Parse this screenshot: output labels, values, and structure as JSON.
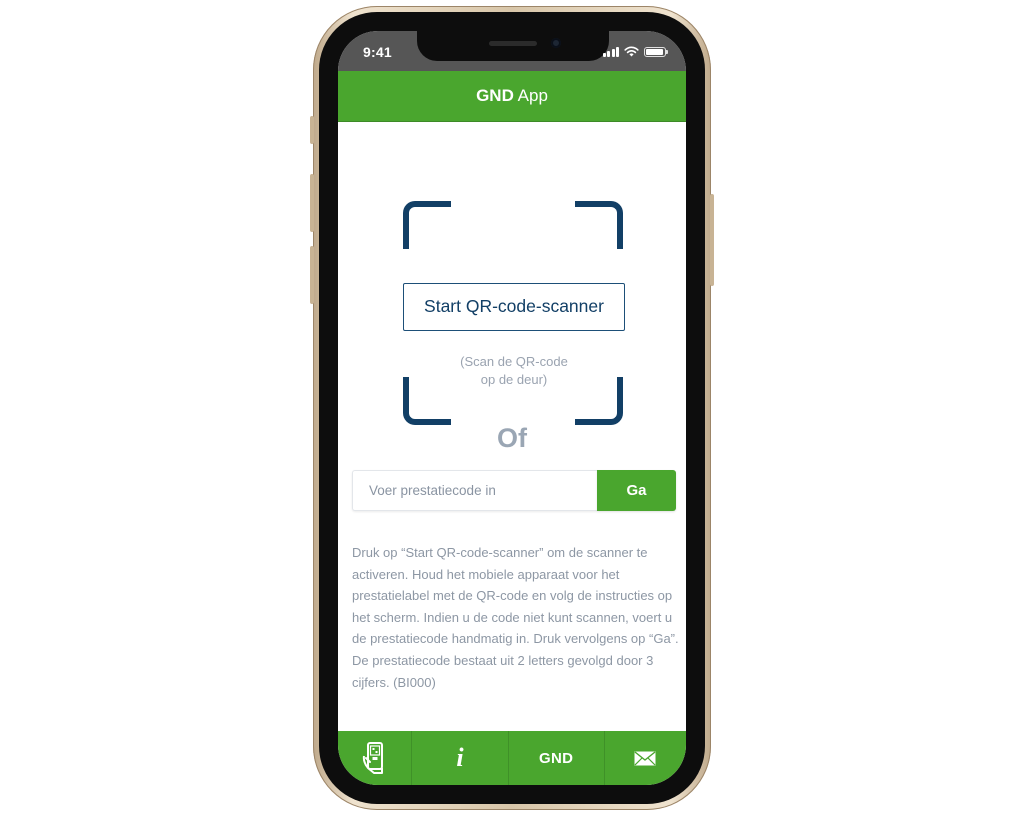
{
  "status_bar": {
    "time": "9:41",
    "icons": [
      "signal-icon",
      "wifi-icon",
      "battery-icon"
    ]
  },
  "header": {
    "title_bold": "GND",
    "title_rest": " App",
    "color": "#4aa62e"
  },
  "scanner": {
    "button_label": "Start QR-code-scanner",
    "hint_line1": "(Scan de QR-code",
    "hint_line2": "op de deur)",
    "frame_color": "#123f66"
  },
  "divider_label": "Of",
  "code_entry": {
    "placeholder": "Voer prestatiecode in",
    "value": "",
    "submit_label": "Ga"
  },
  "instructions": "Druk op “Start QR-code-scanner” om de scanner te activeren. Houd het mobiele apparaat voor het prestatielabel met de QR-code en volg de instructies op het scherm. Indien u de code niet kunt scannen, voert u de prestatiecode handmatig in. Druk vervolgens op “Ga”. De prestatiecode bestaat uit 2 letters gevolgd door 3 cijfers. (BI000)",
  "tab_bar": {
    "items": [
      {
        "name": "scan",
        "icon": "phone-qr-icon",
        "label": ""
      },
      {
        "name": "info",
        "icon": "info-icon",
        "label": "i"
      },
      {
        "name": "gnd",
        "icon": "",
        "label": "GND"
      },
      {
        "name": "mail",
        "icon": "envelope-icon",
        "label": ""
      }
    ]
  }
}
